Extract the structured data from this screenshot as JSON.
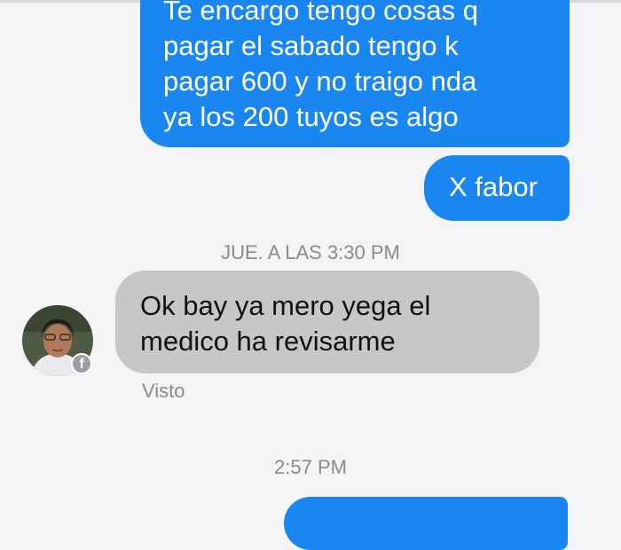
{
  "thread": {
    "messages_before": [
      {
        "lines": [
          "Te encargo tengo cosas q",
          "pagar el sabado tengo k",
          "pagar 600 y no traigo nda",
          "ya los 200 tuyos es algo"
        ]
      },
      {
        "text": "X fabor"
      }
    ],
    "timestamp_1": "JUE. A LAS 3:30 PM",
    "incoming": {
      "lines": [
        "Ok bay ya mero yega el",
        "medico ha revisarme"
      ],
      "status": "Visto",
      "avatar_badge_icon": "facebook-icon"
    },
    "timestamp_2": "2:57 PM"
  },
  "colors": {
    "outgoing_bubble": "#1a86f0",
    "incoming_bubble": "#c7c7c9",
    "background": "#f4f4f6",
    "meta_text": "#8a8a8f"
  }
}
